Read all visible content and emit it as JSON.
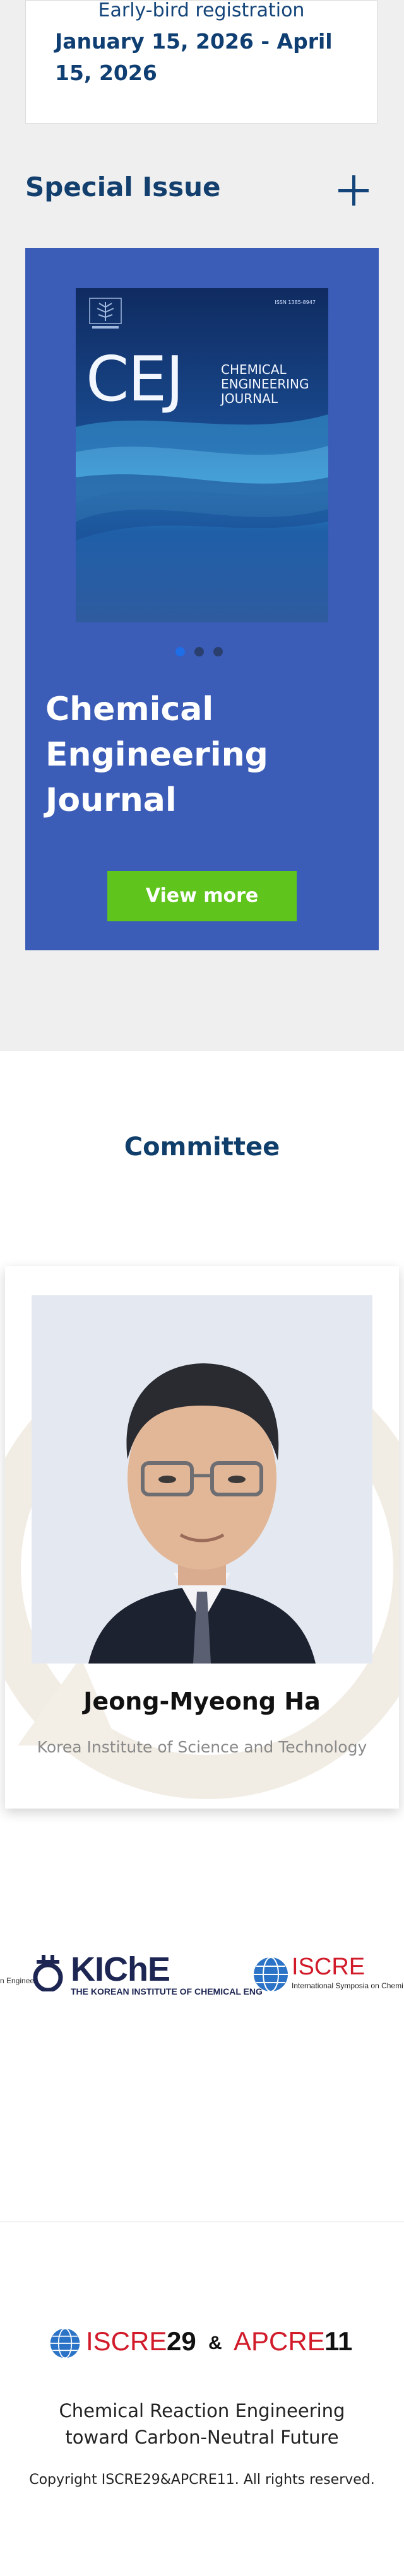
{
  "registration": {
    "label": "Early-bird registration",
    "dates": "January 15, 2026 - April 15, 2026"
  },
  "special_issue": {
    "title": "Special Issue",
    "journal_title": "Chemical Engineering Journal",
    "button_label": "View more",
    "cover": {
      "abbrev": "CEJ",
      "name_lines": [
        "CHEMICAL",
        "ENGINEERING",
        "JOURNAL"
      ],
      "issn": "ISSN 1385-8947"
    },
    "slide_count": 3,
    "active_slide": 1,
    "colors": {
      "panel": "#3b5cb7",
      "button": "#5fc41b",
      "dot_active": "#1e6ee8",
      "dot_inactive": "#2a3f6e"
    }
  },
  "committee": {
    "title": "Committee",
    "member": {
      "name": "Jeong-Myeong Ha",
      "affiliation": "Korea Institute of Science and Technology"
    }
  },
  "partners": {
    "left_cut_text": "n Enginee",
    "kiche": {
      "name": "KIChE",
      "subtitle": "THE KOREAN INSTITUTE OF CHEMICAL ENG"
    },
    "iscre": {
      "name": "ISCRE",
      "subtitle": "International Symposia on Chemi"
    }
  },
  "footer": {
    "logo": {
      "part1": "ISCRE",
      "num1": "29",
      "amp": "&",
      "part2": "APCRE",
      "num2": "11"
    },
    "tagline": "Chemical Reaction Engineering toward Carbon-Neutral Future",
    "copyright": "Copyright ISCRE29&APCRE11. All rights reserved."
  }
}
